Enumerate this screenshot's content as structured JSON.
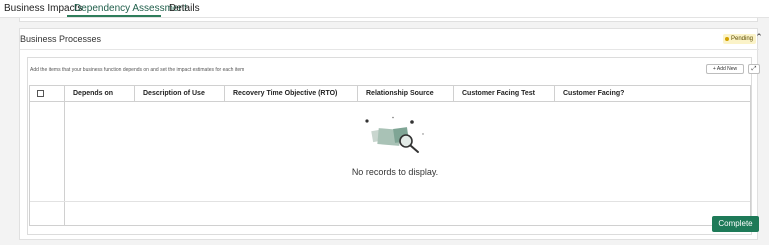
{
  "tabs": [
    {
      "label": "Business Impacts",
      "active": false
    },
    {
      "label": "Dependency Assessment",
      "active": true
    },
    {
      "label": "Details",
      "active": false
    }
  ],
  "section": {
    "title": "Business Processes",
    "status_badge": "Pending"
  },
  "panel": {
    "hint": "Add the items that your business function depends on and set the impact estimates for each item",
    "add_new_label": "Add New"
  },
  "table": {
    "columns": [
      "Depends on",
      "Description of Use",
      "Recovery Time Objective (RTO)",
      "Relationship Source",
      "Customer Facing Test",
      "Customer Facing?"
    ],
    "rows": [],
    "empty_message": "No records to display."
  },
  "actions": {
    "complete_label": "Complete"
  },
  "colors": {
    "accent": "#2e7d5b",
    "primary_button": "#1e7a58",
    "badge_bg": "#fbf3c8"
  }
}
